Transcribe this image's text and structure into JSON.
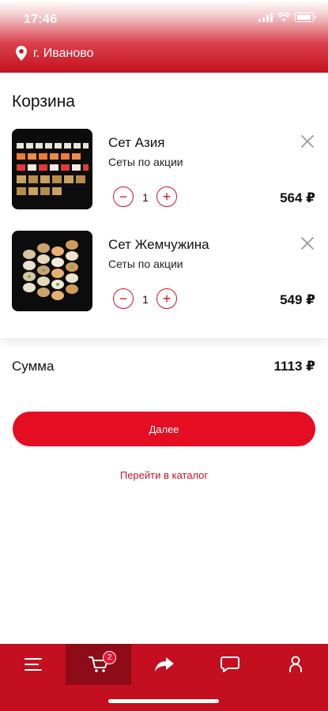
{
  "status": {
    "time": "17:46"
  },
  "header": {
    "city": "г. Иваново",
    "location_icon": "map-pin-icon"
  },
  "page": {
    "title": "Корзина"
  },
  "cart": {
    "items": [
      {
        "name": "Сет Азия",
        "category": "Сеты по акции",
        "quantity": "1",
        "price": "564 ₽",
        "minus": "−",
        "plus": "+"
      },
      {
        "name": "Сет Жемчужина",
        "category": "Сеты по акции",
        "quantity": "1",
        "price": "549 ₽",
        "minus": "−",
        "plus": "+"
      }
    ],
    "sum_label": "Сумма",
    "sum_value": "1113 ₽"
  },
  "actions": {
    "next_label": "Далее",
    "catalog_link": "Перейти в каталог"
  },
  "tabbar": {
    "tabs": [
      {
        "name": "menu",
        "icon": "hamburger-icon"
      },
      {
        "name": "cart",
        "icon": "cart-icon",
        "badge": "2",
        "active": true
      },
      {
        "name": "share",
        "icon": "share-arrow-icon"
      },
      {
        "name": "chat",
        "icon": "chat-bubble-icon"
      },
      {
        "name": "profile",
        "icon": "person-icon"
      }
    ]
  },
  "colors": {
    "accent": "#e50d22",
    "tabbar": "#c30f1f",
    "tab_active": "#8e0c17"
  }
}
